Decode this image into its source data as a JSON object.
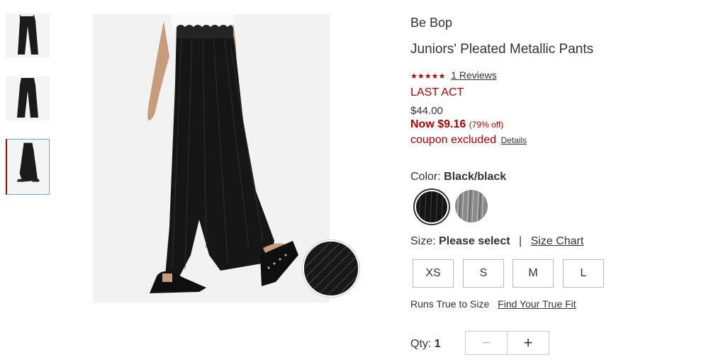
{
  "product": {
    "brand": "Be Bop",
    "name": "Juniors' Pleated Metallic Pants",
    "stars": "★★★★★",
    "reviews": "1 Reviews",
    "badge": "LAST ACT",
    "original_price": "$44.00",
    "now_label": "Now $9.16",
    "discount": "(79% off)",
    "coupon_text": "coupon excluded",
    "coupon_details": "Details"
  },
  "color": {
    "label": "Color:",
    "selected": "Black/black",
    "options": [
      "Black/black",
      "Silver"
    ]
  },
  "size": {
    "label": "Size:",
    "selected": "Please select",
    "separator": "|",
    "chart_link": "Size Chart",
    "options": [
      "XS",
      "S",
      "M",
      "L"
    ]
  },
  "fit": {
    "text": "Runs True to Size",
    "link": "Find Your True Fit"
  },
  "quantity": {
    "label": "Qty:",
    "value": "1",
    "minus": "−",
    "plus": "+"
  },
  "colors": {
    "accent_red": "#b30000",
    "selected_thumb_border": "#6aa7e3"
  }
}
